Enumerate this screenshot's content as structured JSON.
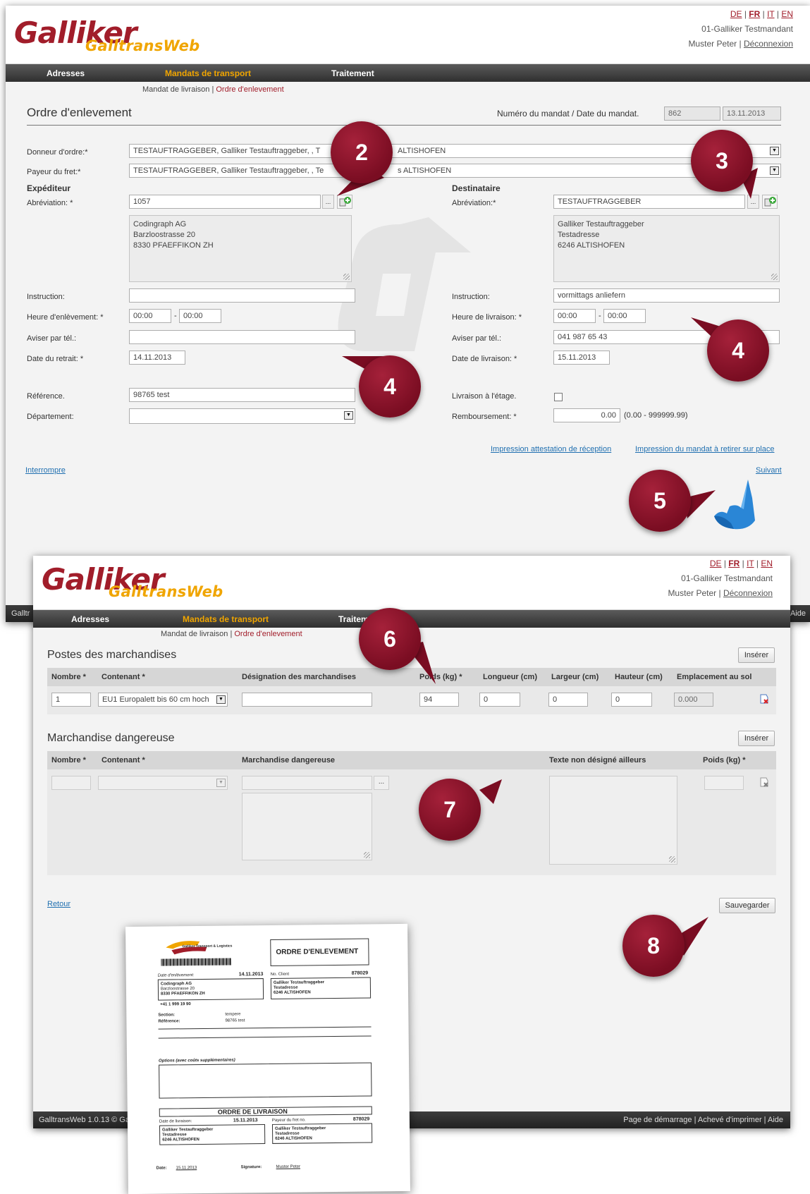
{
  "lang": {
    "de": "DE",
    "fr": "FR",
    "it": "IT",
    "en": "EN"
  },
  "tenant": "01-Galliker Testmandant",
  "user": "Muster Peter",
  "logout": "Déconnexion",
  "logo": {
    "main": "Galliker",
    "sub": "GalltransWeb"
  },
  "nav": {
    "addresses": "Adresses",
    "orders": "Mandats de transport",
    "processing": "Traitement",
    "processing_cut": "Traitem"
  },
  "subnav": {
    "delivery": "Mandat de livraison",
    "pickup": "Ordre d'enlevement"
  },
  "form1": {
    "title": "Ordre d'enlevement",
    "order_label": "Numéro du mandat / Date du mandat.",
    "order_no": "862",
    "order_date": "13.11.2013",
    "principal_label": "Donneur d'ordre:*",
    "principal_value": "TESTAUFTRAGGEBER, Galliker Testauftraggeber, , T",
    "principal_tail": "ALTISHOFEN",
    "payer_label": "Payeur du fret:*",
    "payer_value": "TESTAUFTRAGGEBER, Galliker Testauftraggeber, , Te",
    "payer_tail": "s ALTISHOFEN",
    "sender": {
      "title": "Expéditeur",
      "abbr_label": "Abréviation: *",
      "abbr": "1057",
      "address": [
        "Codingraph AG",
        "Barzloostrasse 20",
        "8330 PFAEFFIKON ZH"
      ]
    },
    "recipient": {
      "title": "Destinataire",
      "abbr_label": "Abréviation:*",
      "abbr": "TESTAUFTRAGGEBER",
      "address": [
        "Galliker Testauftraggeber",
        "Testadresse",
        "6246 ALTISHOFEN"
      ]
    },
    "instruction_label": "Instruction:",
    "instruction_r": "vormittags anliefern",
    "pickup_time_label": "Heure d'enlèvement: *",
    "delivery_time_label": "Heure de livraison: *",
    "time_from": "00:00",
    "time_to": "00:00",
    "dash": "-",
    "phone_label": "Aviser par tél.:",
    "phone_r": "041 987 65 43",
    "pickup_date_label": "Date du retrait: *",
    "pickup_date": "14.11.2013",
    "delivery_date_label": "Date de livraison: *",
    "delivery_date": "15.11.2013",
    "ref_label": "Référence.",
    "ref": "98765 test",
    "dept_label": "Département:",
    "floor_label": "Livraison à l'étage.",
    "refund_label": "Remboursement: *",
    "refund": "0.00",
    "refund_range": "(0.00 - 999999.99)",
    "print1": "Impression attestation de réception",
    "print2": "Impression du mandat à retirer sur place",
    "cancel": "Interrompre",
    "next": "Suivant"
  },
  "form2": {
    "goods_title": "Postes des marchandises",
    "insert": "Insérer",
    "goods_cols": [
      "Nombre *",
      "Contenant *",
      "Désignation des marchandises",
      "Poids (kg) *",
      "Longueur (cm)",
      "Largeur (cm)",
      "Hauteur (cm)",
      "Emplacement au sol"
    ],
    "goods_row": {
      "count": "1",
      "container": "EU1  Europalett bis 60 cm hoch",
      "designation": "",
      "weight": "94",
      "length": "0",
      "width": "0",
      "height": "0",
      "floor": "0.000"
    },
    "danger_title": "Marchandise dangereuse",
    "danger_cols": [
      "Nombre *",
      "Contenant *",
      "Marchandise dangereuse",
      "Texte non désigné ailleurs",
      "Poids (kg) *"
    ],
    "back": "Retour",
    "save": "Sauvegarder",
    "footer_left": "GalltransWeb 1.0.13 © Ga",
    "footer_right": "Page de démarrage | Achevé d'imprimer | Aide"
  },
  "bg_footer": {
    "left": "Galltr",
    "right": "Aide"
  },
  "bubbles": [
    "2",
    "3",
    "4",
    "4",
    "5",
    "6",
    "7",
    "8"
  ],
  "doc": {
    "title": "ORDRE D'ENLEVEMENT",
    "title2": "ORDRE DE LIVRAISON",
    "logo_text": "Galliker Transport & Logistics",
    "pickup_date_lbl": "Date d'enlèvement:",
    "pickup_date": "14.11.2013",
    "cust_lbl": "No. Client",
    "cust_no": "878029",
    "sender": [
      "Codingraph AG",
      "Barzloostrasse 20",
      "8330 PFAEFFIKON ZH",
      "+41 1 999 19 90"
    ],
    "recipient": [
      "Galliker Testauftraggeber",
      "Testadresse",
      "6246 ALTISHOFEN"
    ],
    "section_lbl": "Section:",
    "section": "tempere",
    "ref_lbl": "Référence:",
    "ref": "98765 test",
    "options_lbl": "Options (avec coûts supplémentaires)",
    "deliv_date_lbl": "Date de livraison:",
    "deliv_date": "15.11.2013",
    "payer_lbl": "Payeur du fret no.",
    "payer_no": "878029",
    "date_lbl": "Date:",
    "date": "15.11.2013",
    "sign_lbl": "Signature:",
    "sign": "Muster Peter"
  }
}
